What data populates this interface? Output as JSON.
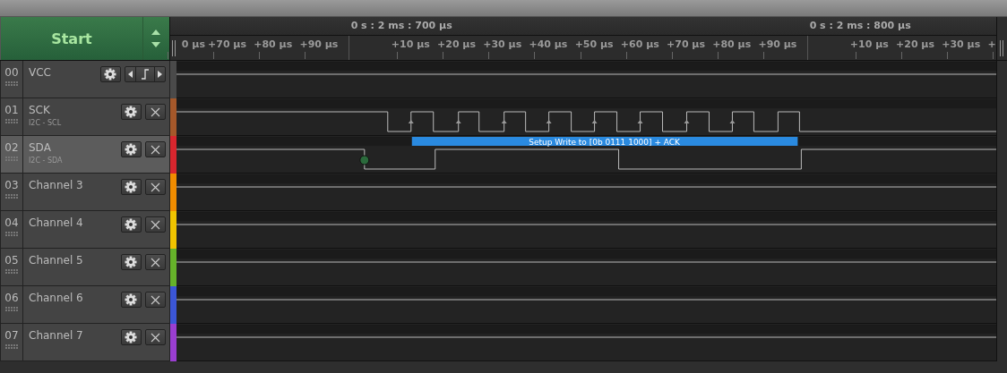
{
  "start_button": {
    "label": "Start"
  },
  "timeline": {
    "markers": [
      {
        "label": "0 s : 2 ms : 700 µs"
      },
      {
        "label": "0 s : 2 ms : 800 µs"
      }
    ],
    "ticks": [
      "0 µs",
      "+70 µs",
      "+80 µs",
      "+90 µs",
      "+10 µs",
      "+20 µs",
      "+30 µs",
      "+40 µs",
      "+50 µs",
      "+60 µs",
      "+70 µs",
      "+80 µs",
      "+90 µs",
      "+10 µs",
      "+20 µs",
      "+30 µs",
      "+"
    ]
  },
  "channels": [
    {
      "number": "00",
      "name": "VCC",
      "kind": "trigger",
      "color": "#4a4a4a",
      "selected": false
    },
    {
      "number": "01",
      "name": "SCK",
      "analyzer": "I2C - SCL",
      "kind": "removable",
      "color": "#a5582a",
      "selected": false
    },
    {
      "number": "02",
      "name": "SDA",
      "analyzer": "I2C - SDA",
      "kind": "removable",
      "color": "#d8262e",
      "selected": true,
      "annotation": "Setup Write to [0b 0111 1000] + ACK"
    },
    {
      "number": "03",
      "name": "Channel 3",
      "kind": "removable",
      "color": "#f08c00",
      "selected": false
    },
    {
      "number": "04",
      "name": "Channel 4",
      "kind": "removable",
      "color": "#f0c400",
      "selected": false
    },
    {
      "number": "05",
      "name": "Channel 5",
      "kind": "removable",
      "color": "#66b22a",
      "selected": false
    },
    {
      "number": "06",
      "name": "Channel 6",
      "kind": "removable",
      "color": "#3b56d6",
      "selected": false
    },
    {
      "number": "07",
      "name": "Channel 7",
      "kind": "removable",
      "color": "#9a3ed0",
      "selected": false
    }
  ]
}
